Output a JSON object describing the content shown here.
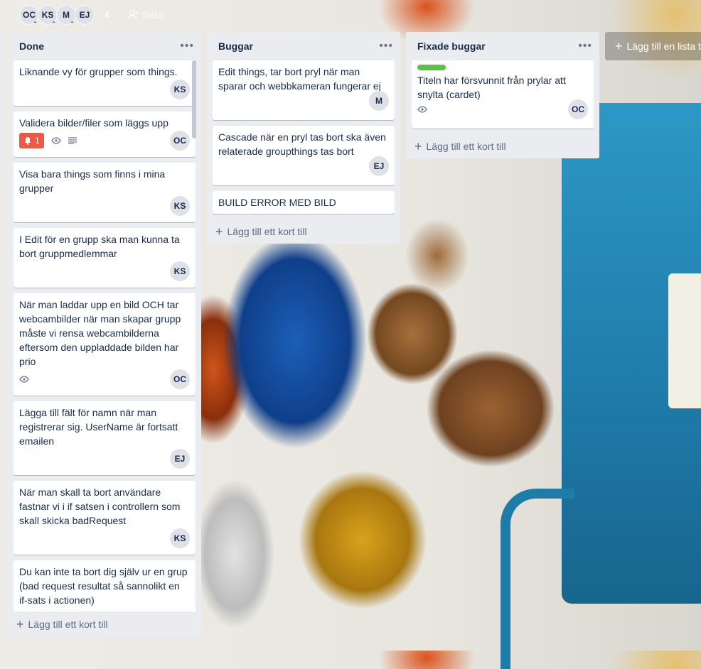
{
  "header": {
    "members": [
      {
        "initials": "OC"
      },
      {
        "initials": "KS"
      },
      {
        "initials": "M"
      },
      {
        "initials": "EJ"
      }
    ],
    "member_count": "4",
    "share_label": "Dela",
    "share_icon": "person-add-icon"
  },
  "lists": [
    {
      "title": "Done",
      "menu": "•••",
      "add_card_label": "Lägg till ett kort till",
      "cards": [
        {
          "title": "Liknande vy för grupper som things.",
          "member": "KS"
        },
        {
          "title": "Validera bilder/filer som läggs upp",
          "member": "OC",
          "due_badge": "1",
          "watching": true,
          "description": true
        },
        {
          "title": "Visa bara things som finns i mina grupper",
          "member": "KS"
        },
        {
          "title": "I Edit för en grupp ska man kunna ta bort gruppmedlemmar",
          "member": "KS"
        },
        {
          "title": "När man laddar upp en bild OCH tar webcambilder när man skapar grupp måste vi rensa webcambilderna eftersom den uppladdade bilden har prio",
          "member": "OC",
          "watching": true
        },
        {
          "title": "Lägga till fält för namn när man registrerar sig. UserName är fortsatt emailen",
          "member": "EJ"
        },
        {
          "title": "När man skall ta bort användare fastnar vi i if satsen i controllern som skall skicka badRequest",
          "member": "KS"
        },
        {
          "title": "Du kan inte ta bort dig själv ur en grup (bad request resultat så sannolikt en if-sats i actionen)",
          "member": ""
        }
      ]
    },
    {
      "title": "Buggar",
      "menu": "•••",
      "add_card_label": "Lägg till ett kort till",
      "cards": [
        {
          "title": "Edit things, tar bort pryl när man sparar och webbkameran fungerar ej",
          "member": "M"
        },
        {
          "title": "Cascade när en pryl tas bort ska även relaterade groupthings tas bort",
          "member": "EJ"
        },
        {
          "title": "BUILD ERROR MED BILD"
        }
      ]
    },
    {
      "title": "Fixade buggar",
      "menu": "•••",
      "add_card_label": "Lägg till ett kort till",
      "label_color": "#61bd4f",
      "cards": [
        {
          "title": "Titeln har försvunnit från prylar att snylta (cardet)",
          "member": "OC",
          "watching": true
        }
      ]
    }
  ],
  "add_list_label": "Lägg till en lista till",
  "colors": {
    "list_bg": "#ebecf0",
    "due_badge": "#eb5a46",
    "label_green": "#61bd4f"
  }
}
